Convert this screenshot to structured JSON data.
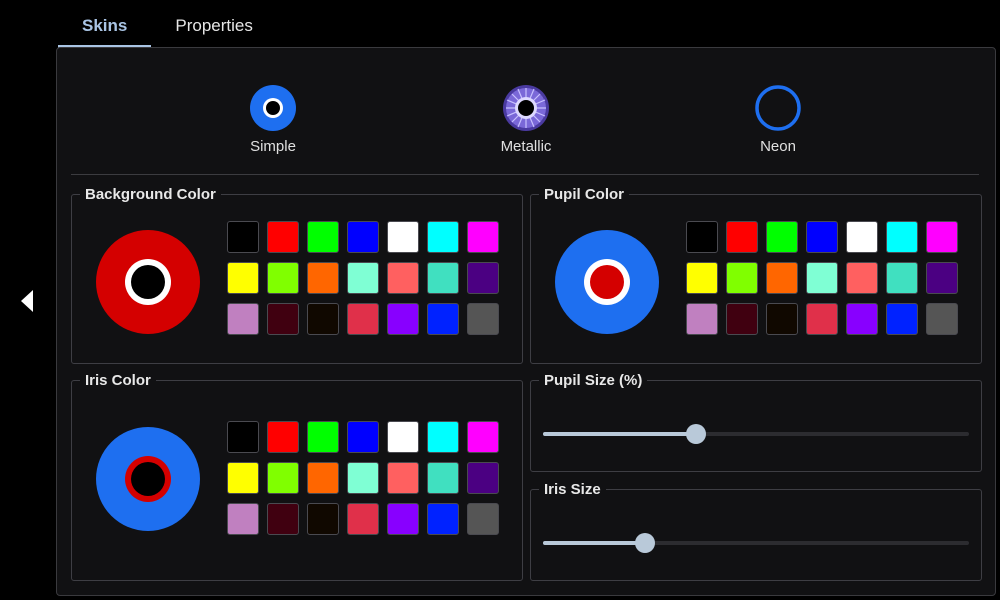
{
  "tabs": [
    {
      "label": "Skins",
      "active": true
    },
    {
      "label": "Properties",
      "active": false
    }
  ],
  "skins": {
    "options": [
      {
        "label": "Simple",
        "icon": "simple-eye-icon"
      },
      {
        "label": "Metallic",
        "icon": "metallic-eye-icon"
      },
      {
        "label": "Neon",
        "icon": "neon-ring-icon"
      }
    ]
  },
  "background_color": {
    "label": "Background Color",
    "preview": {
      "outer": "#d40000",
      "ring": "#ffffff",
      "pupil": "#000000"
    }
  },
  "pupil_color": {
    "label": "Pupil Color",
    "preview": {
      "outer": "#1e6ff0",
      "ring": "#ffffff",
      "pupil": "#d40000"
    }
  },
  "iris_color": {
    "label": "Iris Color",
    "preview": {
      "outer": "#1e6ff0",
      "ring": "#d40000",
      "pupil": "#000000"
    }
  },
  "palette": [
    "#000000",
    "#ff0000",
    "#00ff00",
    "#0000ff",
    "#ffffff",
    "#00ffff",
    "#ff00ff",
    "#ffff00",
    "#80ff00",
    "#ff6600",
    "#7fffd4",
    "#ff6060",
    "#40e0c0",
    "#4b0082",
    "#c080c0",
    "#400010",
    "#100800",
    "#e0304a",
    "#8800ff",
    "#0022ff",
    "#555555"
  ],
  "pupil_size": {
    "label": "Pupil Size (%)",
    "value_percent": 36
  },
  "iris_size": {
    "label": "Iris Size",
    "value_percent": 24
  },
  "colors": {
    "accent": "#a9c4e4",
    "slider": "#b9c9d9"
  }
}
